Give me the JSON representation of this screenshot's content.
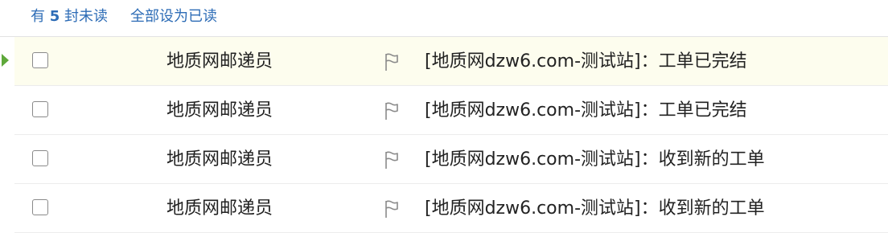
{
  "header": {
    "unread_prefix": "有",
    "unread_count": "5",
    "unread_suffix": "封未读",
    "mark_all_read": "全部设为已读"
  },
  "colors": {
    "link": "#2d6cb6",
    "active_row": "#fdfdee",
    "marker": "#5ea83a"
  },
  "mails": [
    {
      "sender": "地质网邮递员",
      "subject": "[地质网dzw6.com-测试站]：工单已完结",
      "active": true
    },
    {
      "sender": "地质网邮递员",
      "subject": "[地质网dzw6.com-测试站]：工单已完结",
      "active": false
    },
    {
      "sender": "地质网邮递员",
      "subject": "[地质网dzw6.com-测试站]：收到新的工单",
      "active": false
    },
    {
      "sender": "地质网邮递员",
      "subject": "[地质网dzw6.com-测试站]：收到新的工单",
      "active": false
    }
  ]
}
